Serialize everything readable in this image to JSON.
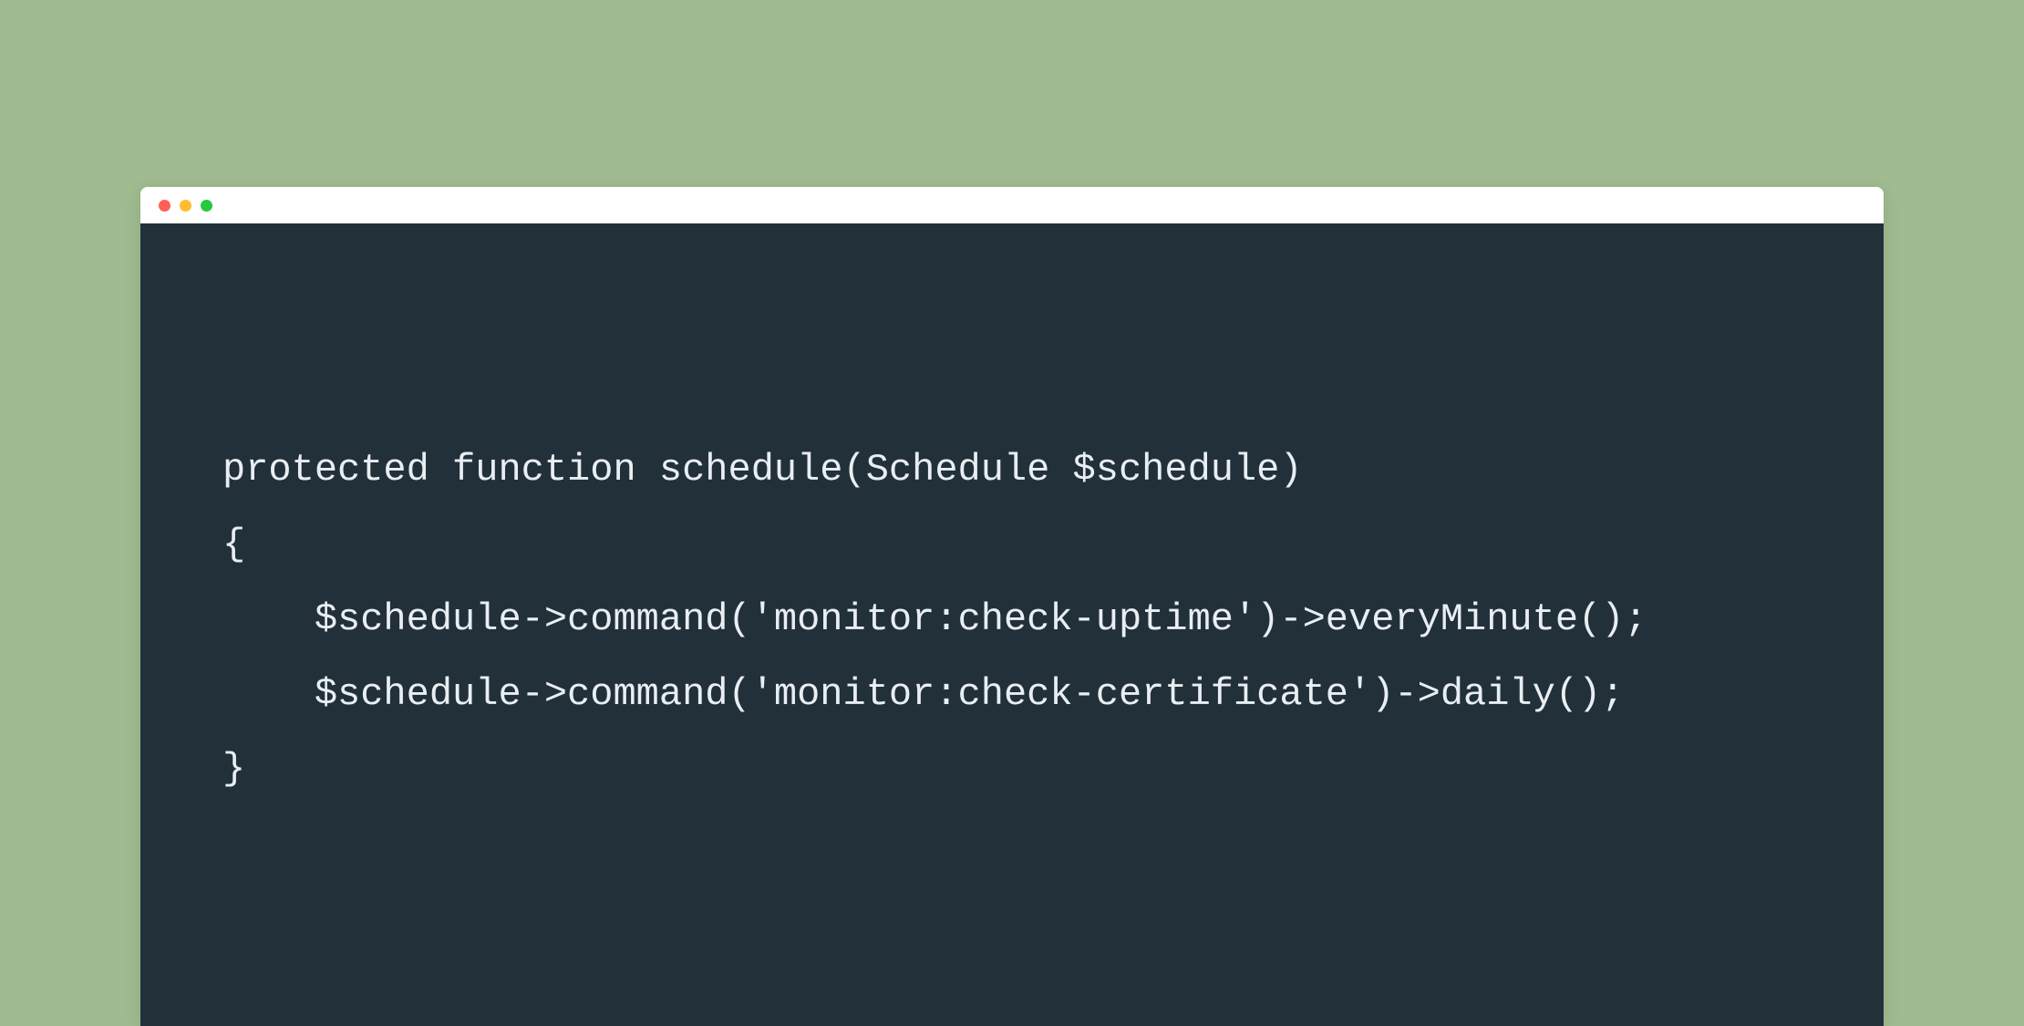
{
  "code": {
    "line1": "protected function schedule(Schedule $schedule)",
    "line2": "{",
    "line3": "    $schedule->command('monitor:check-uptime')->everyMinute();",
    "line4": "    $schedule->command('monitor:check-certificate')->daily();",
    "line5": "}"
  }
}
